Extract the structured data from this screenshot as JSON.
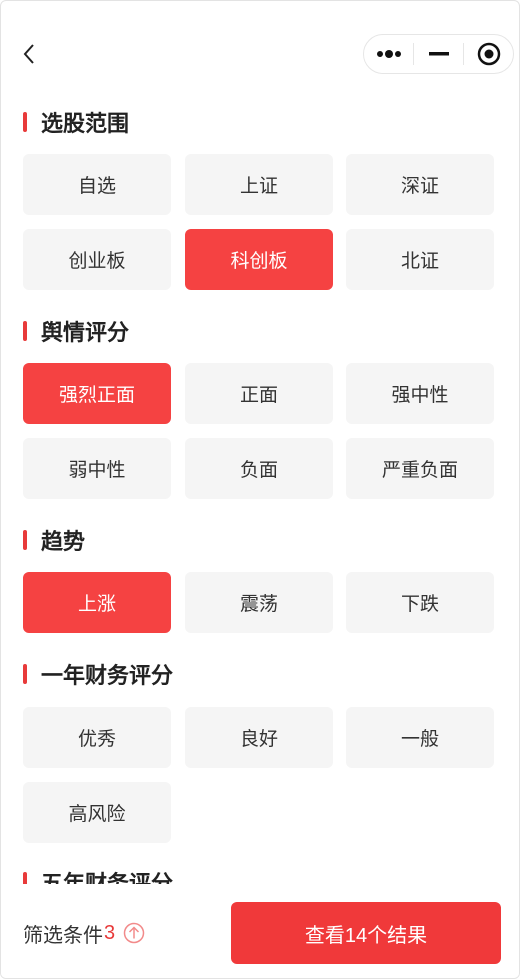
{
  "sections": [
    {
      "title": "选股范围",
      "options": [
        {
          "label": "自选",
          "active": false
        },
        {
          "label": "上证",
          "active": false
        },
        {
          "label": "深证",
          "active": false
        },
        {
          "label": "创业板",
          "active": false
        },
        {
          "label": "科创板",
          "active": true
        },
        {
          "label": "北证",
          "active": false
        }
      ]
    },
    {
      "title": "舆情评分",
      "options": [
        {
          "label": "强烈正面",
          "active": true
        },
        {
          "label": "正面",
          "active": false
        },
        {
          "label": "强中性",
          "active": false
        },
        {
          "label": "弱中性",
          "active": false
        },
        {
          "label": "负面",
          "active": false
        },
        {
          "label": "严重负面",
          "active": false
        }
      ]
    },
    {
      "title": "趋势",
      "options": [
        {
          "label": "上涨",
          "active": true
        },
        {
          "label": "震荡",
          "active": false
        },
        {
          "label": "下跌",
          "active": false
        }
      ]
    },
    {
      "title": "一年财务评分",
      "options": [
        {
          "label": "优秀",
          "active": false
        },
        {
          "label": "良好",
          "active": false
        },
        {
          "label": "一般",
          "active": false
        },
        {
          "label": "高风险",
          "active": false
        }
      ]
    },
    {
      "title": "五年财务评分",
      "options": []
    }
  ],
  "footer": {
    "conditions_label": "筛选条件",
    "conditions_count": "3",
    "result_button": "查看14个结果"
  },
  "colors": {
    "accent": "#f54242",
    "title_bar": "#e83a3a",
    "option_bg": "#f5f5f5"
  }
}
